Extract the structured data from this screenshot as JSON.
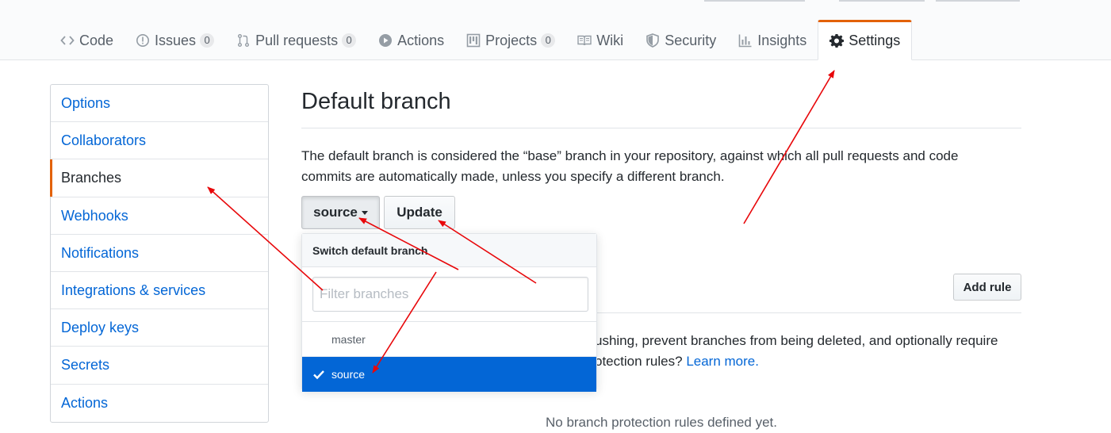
{
  "tabs": [
    {
      "label": "Code",
      "icon": "code-icon"
    },
    {
      "label": "Issues",
      "icon": "issue-icon",
      "count": "0"
    },
    {
      "label": "Pull requests",
      "icon": "pull-request-icon",
      "count": "0"
    },
    {
      "label": "Actions",
      "icon": "play-icon"
    },
    {
      "label": "Projects",
      "icon": "project-icon",
      "count": "0"
    },
    {
      "label": "Wiki",
      "icon": "book-icon"
    },
    {
      "label": "Security",
      "icon": "shield-icon"
    },
    {
      "label": "Insights",
      "icon": "graph-icon"
    },
    {
      "label": "Settings",
      "icon": "gear-icon",
      "selected": true
    }
  ],
  "sidebar": {
    "items": [
      {
        "label": "Options"
      },
      {
        "label": "Collaborators"
      },
      {
        "label": "Branches",
        "selected": true
      },
      {
        "label": "Webhooks"
      },
      {
        "label": "Notifications"
      },
      {
        "label": "Integrations & services"
      },
      {
        "label": "Deploy keys"
      },
      {
        "label": "Secrets"
      },
      {
        "label": "Actions"
      }
    ]
  },
  "main": {
    "title": "Default branch",
    "description": "The default branch is considered the “base” branch in your repository, against which all pull requests and code commits are automatically made, unless you specify a different branch.",
    "branch_button_label": "source",
    "update_button_label": "Update",
    "add_rule_label": "Add rule",
    "protection_text": "ushing, prevent branches from being deleted, and optionally require",
    "protection_text_2": "otection rules?",
    "learn_more_label": "Learn more.",
    "empty_text": "No branch protection rules defined yet."
  },
  "dropdown": {
    "header": "Switch default branch",
    "filter_placeholder": "Filter branches",
    "branches": [
      {
        "name": "master",
        "selected": false
      },
      {
        "name": "source",
        "selected": true
      }
    ]
  },
  "colors": {
    "accent": "#e36209",
    "link": "#0366d6",
    "selected_bg": "#0366d6",
    "annotation_arrow": "#e8070a"
  }
}
